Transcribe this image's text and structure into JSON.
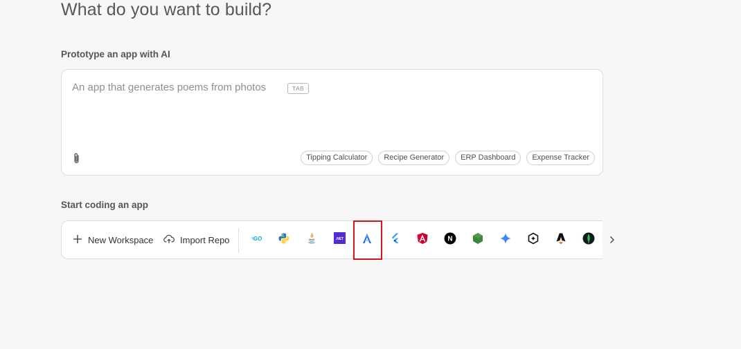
{
  "page": {
    "title": "What do you want to build?"
  },
  "prototype": {
    "label": "Prototype an app with AI",
    "placeholder": "An app that generates poems from photos",
    "tab_hint": "TAB",
    "attach_icon": "paperclip-icon",
    "suggestions": [
      "Tipping Calculator",
      "Recipe Generator",
      "ERP Dashboard",
      "Expense Tracker"
    ]
  },
  "start_coding": {
    "label": "Start coding an app",
    "new_workspace_label": "New Workspace",
    "new_workspace_icon": "plus-icon",
    "import_repo_label": "Import Repo",
    "import_repo_icon": "cloud-upload-icon",
    "templates": [
      {
        "name": "go-icon",
        "text": "GO"
      },
      {
        "name": "python-icon",
        "text": ""
      },
      {
        "name": "java-icon",
        "text": ""
      },
      {
        "name": "dotnet-icon",
        "text": ".NET"
      },
      {
        "name": "astro-like-icon",
        "text": "",
        "highlighted": true
      },
      {
        "name": "flutter-icon",
        "text": ""
      },
      {
        "name": "angular-icon",
        "text": ""
      },
      {
        "name": "nextjs-icon",
        "text": "N"
      },
      {
        "name": "nodejs-icon",
        "text": ""
      },
      {
        "name": "gemini-icon",
        "text": ""
      },
      {
        "name": "hexagon-plus-icon",
        "text": ""
      },
      {
        "name": "astro-icon",
        "text": ""
      },
      {
        "name": "mongodb-icon",
        "text": ""
      }
    ],
    "next_icon": "chevron-right-icon"
  },
  "colors": {
    "highlight": "#d4121a",
    "go": "#00acd7",
    "python_blue": "#3776ab",
    "python_yellow": "#ffd43b",
    "dotnet": "#512bd4",
    "flutter": "#42a5f5",
    "angular": "#dd0031",
    "node": "#3c873a",
    "gemini": "#4285f4",
    "mongodb": "#13aa52"
  }
}
